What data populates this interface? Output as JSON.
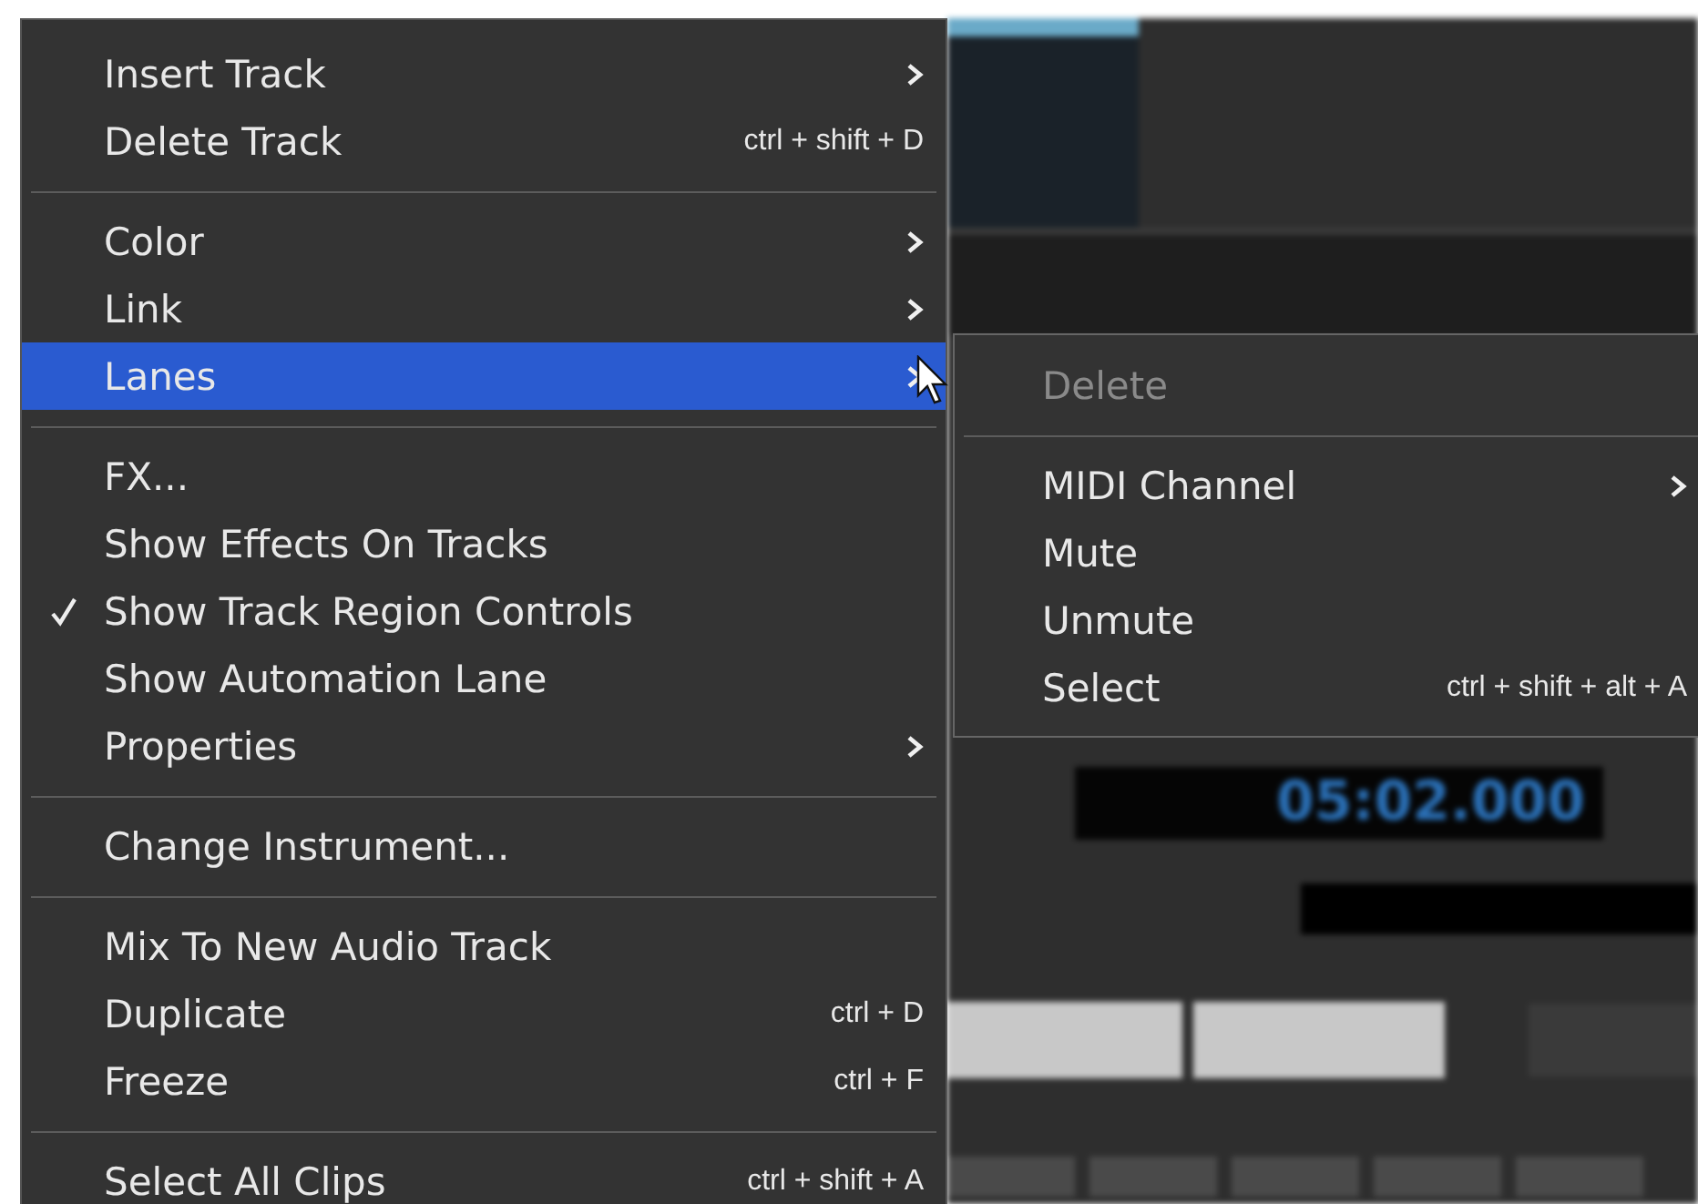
{
  "background": {
    "timer": "05:02.000"
  },
  "menu": {
    "sections": [
      [
        {
          "label": "Insert Track",
          "submenu": true,
          "checked": false,
          "selected": false
        },
        {
          "label": "Delete Track",
          "shortcut": "ctrl + shift + D",
          "submenu": false,
          "checked": false,
          "selected": false
        }
      ],
      [
        {
          "label": "Color",
          "submenu": true,
          "checked": false,
          "selected": false
        },
        {
          "label": "Link",
          "submenu": true,
          "checked": false,
          "selected": false
        },
        {
          "label": "Lanes",
          "submenu": true,
          "checked": false,
          "selected": true
        }
      ],
      [
        {
          "label": "FX...",
          "submenu": false,
          "checked": false,
          "selected": false
        },
        {
          "label": "Show Effects On Tracks",
          "submenu": false,
          "checked": false,
          "selected": false
        },
        {
          "label": "Show Track Region Controls",
          "submenu": false,
          "checked": true,
          "selected": false
        },
        {
          "label": "Show Automation Lane",
          "submenu": false,
          "checked": false,
          "selected": false
        },
        {
          "label": "Properties",
          "submenu": true,
          "checked": false,
          "selected": false
        }
      ],
      [
        {
          "label": "Change Instrument...",
          "submenu": false,
          "checked": false,
          "selected": false
        }
      ],
      [
        {
          "label": "Mix To New Audio Track",
          "submenu": false,
          "checked": false,
          "selected": false
        },
        {
          "label": "Duplicate",
          "shortcut": "ctrl + D",
          "submenu": false,
          "checked": false,
          "selected": false
        },
        {
          "label": "Freeze",
          "shortcut": "ctrl + F",
          "submenu": false,
          "checked": false,
          "selected": false
        }
      ],
      [
        {
          "label": "Select All Clips",
          "shortcut": "ctrl + shift + A",
          "submenu": false,
          "checked": false,
          "selected": false
        }
      ]
    ]
  },
  "submenu": {
    "sections": [
      [
        {
          "label": "Delete",
          "submenu": false,
          "disabled": true
        }
      ],
      [
        {
          "label": "MIDI Channel",
          "submenu": true,
          "disabled": false
        },
        {
          "label": "Mute",
          "submenu": false,
          "disabled": false
        },
        {
          "label": "Unmute",
          "submenu": false,
          "disabled": false
        },
        {
          "label": "Select",
          "shortcut": "ctrl + shift + alt + A",
          "submenu": false,
          "disabled": false
        }
      ]
    ]
  }
}
